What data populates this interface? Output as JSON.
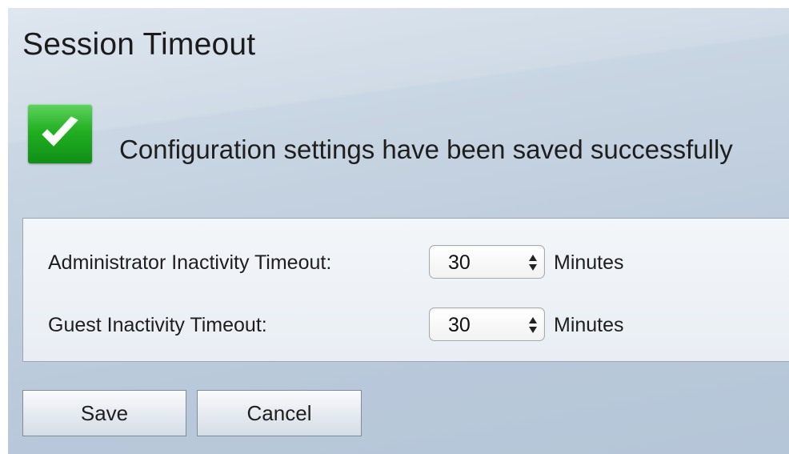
{
  "page": {
    "title": "Session Timeout"
  },
  "status": {
    "icon": "checkmark-icon",
    "message": "Configuration settings have been saved successfully",
    "color": "#22b022"
  },
  "form": {
    "rows": [
      {
        "label": "Administrator Inactivity Timeout:",
        "value": "30",
        "unit": "Minutes"
      },
      {
        "label": "Guest Inactivity Timeout:",
        "value": "30",
        "unit": "Minutes"
      }
    ]
  },
  "buttons": {
    "save_label": "Save",
    "cancel_label": "Cancel"
  }
}
